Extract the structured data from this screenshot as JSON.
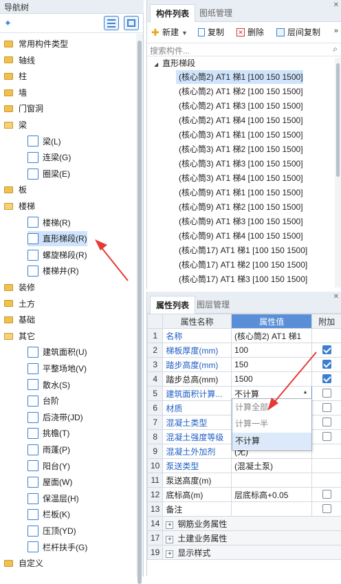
{
  "nav": {
    "title": "导航树",
    "items": [
      {
        "label": "常用构件类型",
        "type": "folder"
      },
      {
        "label": "轴线",
        "type": "folder"
      },
      {
        "label": "柱",
        "type": "folder"
      },
      {
        "label": "墙",
        "type": "folder"
      },
      {
        "label": "门窗洞",
        "type": "folder"
      },
      {
        "label": "梁",
        "type": "folder-open"
      },
      {
        "label": "梁(L)",
        "type": "child"
      },
      {
        "label": "连梁(G)",
        "type": "child"
      },
      {
        "label": "圈梁(E)",
        "type": "child"
      },
      {
        "label": "板",
        "type": "folder"
      },
      {
        "label": "楼梯",
        "type": "folder-open"
      },
      {
        "label": "楼梯(R)",
        "type": "child"
      },
      {
        "label": "直形梯段(R)",
        "type": "child",
        "selected": true
      },
      {
        "label": "螺旋梯段(R)",
        "type": "child"
      },
      {
        "label": "楼梯井(R)",
        "type": "child"
      },
      {
        "label": "装修",
        "type": "folder"
      },
      {
        "label": "土方",
        "type": "folder"
      },
      {
        "label": "基础",
        "type": "folder"
      },
      {
        "label": "其它",
        "type": "folder-open"
      },
      {
        "label": "建筑面积(U)",
        "type": "child"
      },
      {
        "label": "平整场地(V)",
        "type": "child"
      },
      {
        "label": "散水(S)",
        "type": "child"
      },
      {
        "label": "台阶",
        "type": "child"
      },
      {
        "label": "后浇带(JD)",
        "type": "child"
      },
      {
        "label": "挑檐(T)",
        "type": "child"
      },
      {
        "label": "雨蓬(P)",
        "type": "child"
      },
      {
        "label": "阳台(Y)",
        "type": "child"
      },
      {
        "label": "屋面(W)",
        "type": "child"
      },
      {
        "label": "保温层(H)",
        "type": "child"
      },
      {
        "label": "栏板(K)",
        "type": "child"
      },
      {
        "label": "压顶(YD)",
        "type": "child"
      },
      {
        "label": "栏杆扶手(G)",
        "type": "child"
      },
      {
        "label": "自定义",
        "type": "folder"
      }
    ]
  },
  "components": {
    "tabs": [
      "构件列表",
      "图纸管理"
    ],
    "toolbar": {
      "new": "新建",
      "copy": "复制",
      "delete": "删除",
      "floor_copy": "层间复制"
    },
    "search_placeholder": "搜索构件...",
    "group": "直形梯段",
    "items": [
      "(核心筒2)  AT1 梯1 [100 150 1500]",
      "(核心筒2)  AT1 梯2 [100 150 1500]",
      "(核心筒2)  AT1 梯3 [100 150 1500]",
      "(核心筒2)  AT1 梯4 [100 150 1500]",
      "(核心筒3)  AT1 梯1 [100 150 1500]",
      "(核心筒3)  AT1 梯2 [100 150 1500]",
      "(核心筒3)  AT1 梯3 [100 150 1500]",
      "(核心筒3)  AT1 梯4 [100 150 1500]",
      "(核心筒9)  AT1 梯1 [100 150 1500]",
      "(核心筒9)  AT1 梯2 [100 150 1500]",
      "(核心筒9)  AT1 梯3 [100 150 1500]",
      "(核心筒9)  AT1 梯4 [100 150 1500]",
      "(核心筒17)  AT1 梯1 [100 150 1500]",
      "(核心筒17)  AT1 梯2 [100 150 1500]",
      "(核心筒17)  AT1 梯3 [100 150 1500]"
    ]
  },
  "properties": {
    "tabs": [
      "属性列表",
      "图层管理"
    ],
    "headers": {
      "name": "属性名称",
      "value": "属性值",
      "extra": "附加"
    },
    "rows": [
      {
        "n": "1",
        "name": "名称",
        "value": "(核心筒2)  AT1 梯1",
        "blue": true,
        "cb": "none"
      },
      {
        "n": "2",
        "name": "梯板厚度(mm)",
        "value": "100",
        "blue": true,
        "cb": "on"
      },
      {
        "n": "3",
        "name": "踏步高度(mm)",
        "value": "150",
        "blue": true,
        "cb": "on"
      },
      {
        "n": "4",
        "name": "踏步总高(mm)",
        "value": "1500",
        "blue": false,
        "cb": "on"
      },
      {
        "n": "5",
        "name": "建筑面积计算...",
        "value": "不计算",
        "blue": true,
        "cb": "off"
      },
      {
        "n": "6",
        "name": "材质",
        "value": "",
        "blue": true,
        "cb": "off"
      },
      {
        "n": "7",
        "name": "混凝土类型",
        "value": "",
        "blue": true,
        "cb": "off"
      },
      {
        "n": "8",
        "name": "混凝土强度等级",
        "value": "",
        "blue": true,
        "cb": "off"
      },
      {
        "n": "9",
        "name": "混凝土外加剂",
        "value": "(无)",
        "blue": true,
        "cb": "none"
      },
      {
        "n": "10",
        "name": "泵送类型",
        "value": "(混凝土泵)",
        "blue": true,
        "cb": "none"
      },
      {
        "n": "11",
        "name": "泵送高度(m)",
        "value": "",
        "blue": false,
        "cb": "none"
      },
      {
        "n": "12",
        "name": "底标高(m)",
        "value": "层底标高+0.05",
        "blue": false,
        "cb": "off"
      },
      {
        "n": "13",
        "name": "备注",
        "value": "",
        "blue": false,
        "cb": "off"
      },
      {
        "n": "14",
        "name": "钢筋业务属性",
        "value": "",
        "group": true
      },
      {
        "n": "17",
        "name": "土建业务属性",
        "value": "",
        "group": true
      },
      {
        "n": "19",
        "name": "显示样式",
        "value": "",
        "group": true
      }
    ],
    "dropdown": [
      "计算全部",
      "计算一半",
      "不计算"
    ]
  },
  "colors": {
    "accent": "#5a8fd8",
    "selection": "#cfe4fb",
    "arrow": "#e53935"
  }
}
